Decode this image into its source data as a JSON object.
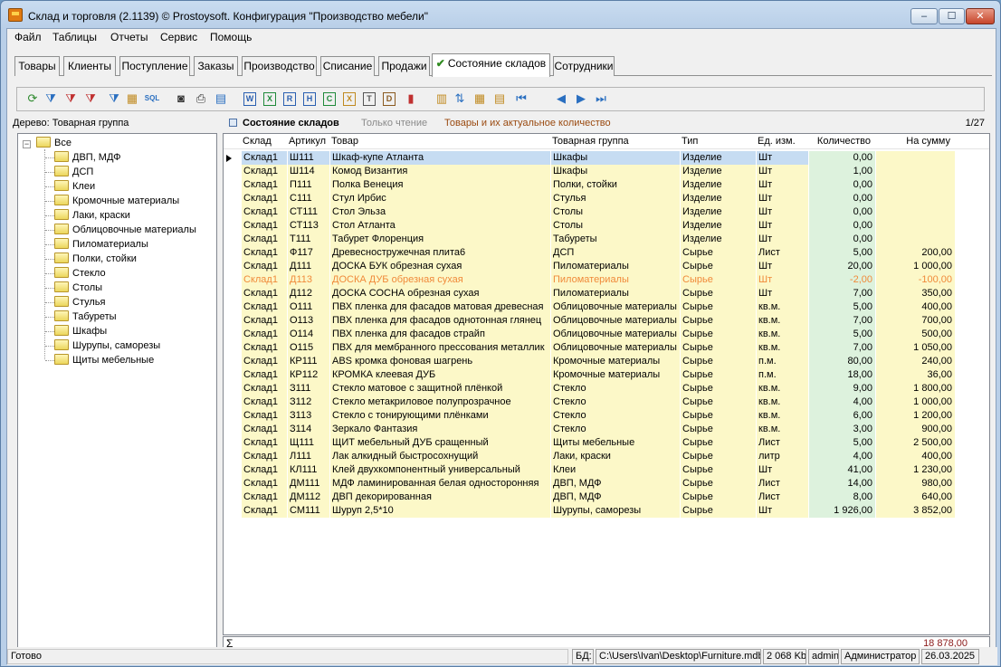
{
  "window": {
    "title": "Склад и торговля (2.1139) © Prostoysoft. Конфигурация \"Производство мебели\"",
    "minimize": "‒",
    "maximize": "☐",
    "close": "✕"
  },
  "menu": [
    "Файл",
    "Таблицы",
    "Отчеты",
    "Сервис",
    "Помощь"
  ],
  "tabs": [
    {
      "label": "Товары",
      "active": false
    },
    {
      "label": "Клиенты",
      "active": false
    },
    {
      "label": "Поступление",
      "active": false
    },
    {
      "label": "Заказы",
      "active": false
    },
    {
      "label": "Производство",
      "active": false
    },
    {
      "label": "Списание",
      "active": false
    },
    {
      "label": "Продажи",
      "active": false
    },
    {
      "label": "Состояние складов",
      "active": true
    },
    {
      "label": "Сотрудники",
      "active": false
    }
  ],
  "toolbar_icons": [
    "refresh-icon",
    "filter-icon",
    "filter-remove-icon",
    "filter-clear-icon",
    "filter-check-icon",
    "group-icon",
    "sql-icon",
    "binoculars-icon",
    "print-icon",
    "preview-icon",
    "export-word-icon",
    "export-excel-icon",
    "export-rtf-icon",
    "export-html-icon",
    "export-csv-icon",
    "export-xml-icon",
    "export-txt-icon",
    "export-dbf-icon",
    "chart-icon",
    "columns-icon",
    "sort-icon",
    "table-settings-icon",
    "form-icon",
    "first-record-icon",
    "prev-record-icon",
    "next-record-icon",
    "last-record-icon"
  ],
  "tree": {
    "label": "Дерево: Товарная группа",
    "expander": "−",
    "root": "Все",
    "items": [
      "ДВП, МДФ",
      "ДСП",
      "Клеи",
      "Кромочные материалы",
      "Лаки, краски",
      "Облицовочные материалы",
      "Пиломатериалы",
      "Полки, стойки",
      "Стекло",
      "Столы",
      "Стулья",
      "Табуреты",
      "Шкафы",
      "Шурупы, саморезы",
      "Щиты мебельные"
    ]
  },
  "grid": {
    "title": "Состояние складов",
    "mode": "Только чтение",
    "description": "Товары и их актуальное количество",
    "pager": "1/27",
    "columns": [
      "Склад",
      "Артикул",
      "Товар",
      "Товарная группа",
      "Тип",
      "Ед. изм.",
      "Количество",
      "На сумму"
    ],
    "rows": [
      [
        "Склад1",
        "Ш111",
        "Шкаф-купе Атланта",
        "Шкафы",
        "Изделие",
        "Шт",
        "0,00",
        ""
      ],
      [
        "Склад1",
        "Ш114",
        "Комод Византия",
        "Шкафы",
        "Изделие",
        "Шт",
        "1,00",
        ""
      ],
      [
        "Склад1",
        "П111",
        "Полка Венеция",
        "Полки, стойки",
        "Изделие",
        "Шт",
        "0,00",
        ""
      ],
      [
        "Склад1",
        "С111",
        "Стул Ирбис",
        "Стулья",
        "Изделие",
        "Шт",
        "0,00",
        ""
      ],
      [
        "Склад1",
        "СТ111",
        "Стол Эльза",
        "Столы",
        "Изделие",
        "Шт",
        "0,00",
        ""
      ],
      [
        "Склад1",
        "СТ113",
        "Стол Атланта",
        "Столы",
        "Изделие",
        "Шт",
        "0,00",
        ""
      ],
      [
        "Склад1",
        "Т111",
        "Табурет Флоренция",
        "Табуреты",
        "Изделие",
        "Шт",
        "0,00",
        ""
      ],
      [
        "Склад1",
        "Ф117",
        "Древесностружечная плита6",
        "ДСП",
        "Сырье",
        "Лист",
        "5,00",
        "200,00"
      ],
      [
        "Склад1",
        "Д111",
        "ДОСКА БУК обрезная сухая",
        "Пиломатериалы",
        "Сырье",
        "Шт",
        "20,00",
        "1 000,00"
      ],
      [
        "Склад1",
        "Д113",
        "ДОСКА ДУБ обрезная сухая",
        "Пиломатериалы",
        "Сырье",
        "Шт",
        "-2,00",
        "-100,00"
      ],
      [
        "Склад1",
        "Д112",
        "ДОСКА СОСНА обрезная сухая",
        "Пиломатериалы",
        "Сырье",
        "Шт",
        "7,00",
        "350,00"
      ],
      [
        "Склад1",
        "О111",
        "ПВХ пленка для фасадов матовая древесная",
        "Облицовочные материалы",
        "Сырье",
        "кв.м.",
        "5,00",
        "400,00"
      ],
      [
        "Склад1",
        "О113",
        "ПВХ пленка для фасадов однотонная глянец",
        "Облицовочные материалы",
        "Сырье",
        "кв.м.",
        "7,00",
        "700,00"
      ],
      [
        "Склад1",
        "О114",
        "ПВХ пленка для фасадов страйп",
        "Облицовочные материалы",
        "Сырье",
        "кв.м.",
        "5,00",
        "500,00"
      ],
      [
        "Склад1",
        "О115",
        "ПВХ для мембранного прессования металлик",
        "Облицовочные материалы",
        "Сырье",
        "кв.м.",
        "7,00",
        "1 050,00"
      ],
      [
        "Склад1",
        "КР111",
        "ABS кромка фоновая шагрень",
        "Кромочные материалы",
        "Сырье",
        "п.м.",
        "80,00",
        "240,00"
      ],
      [
        "Склад1",
        "КР112",
        "КРОМКА клеевая ДУБ",
        "Кромочные материалы",
        "Сырье",
        "п.м.",
        "18,00",
        "36,00"
      ],
      [
        "Склад1",
        "З111",
        "Стекло матовое с защитной плёнкой",
        "Стекло",
        "Сырье",
        "кв.м.",
        "9,00",
        "1 800,00"
      ],
      [
        "Склад1",
        "З112",
        "Стекло метакриловое полупрозрачное",
        "Стекло",
        "Сырье",
        "кв.м.",
        "4,00",
        "1 000,00"
      ],
      [
        "Склад1",
        "З113",
        "Стекло с тонирующими плёнками",
        "Стекло",
        "Сырье",
        "кв.м.",
        "6,00",
        "1 200,00"
      ],
      [
        "Склад1",
        "З114",
        "Зеркало Фантазия",
        "Стекло",
        "Сырье",
        "кв.м.",
        "3,00",
        "900,00"
      ],
      [
        "Склад1",
        "Щ111",
        "ЩИТ мебельный ДУБ сращенный",
        "Щиты мебельные",
        "Сырье",
        "Лист",
        "5,00",
        "2 500,00"
      ],
      [
        "Склад1",
        "Л111",
        "Лак алкидный быстросохнущий",
        "Лаки, краски",
        "Сырье",
        "литр",
        "4,00",
        "400,00"
      ],
      [
        "Склад1",
        "КЛ111",
        "Клей двухкомпонентный универсальный",
        "Клеи",
        "Сырье",
        "Шт",
        "41,00",
        "1 230,00"
      ],
      [
        "Склад1",
        "ДМ111",
        "МДФ ламинированная белая односторонняя",
        "ДВП, МДФ",
        "Сырье",
        "Лист",
        "14,00",
        "980,00"
      ],
      [
        "Склад1",
        "ДМ112",
        "ДВП декорированная",
        "ДВП, МДФ",
        "Сырье",
        "Лист",
        "8,00",
        "640,00"
      ],
      [
        "Склад1",
        "СМ111",
        "Шуруп 2,5*10",
        "Шурупы, саморезы",
        "Сырье",
        "Шт",
        "1 926,00",
        "3 852,00"
      ]
    ],
    "highlight_row": 9,
    "highlight_color": "#f08a3a",
    "selected_row": 0,
    "sum_symbol": "Σ",
    "total": "18 878,00",
    "total_color": "#8b1a1a"
  },
  "status": {
    "ready": "Готово",
    "db_label": "БД:",
    "db_path": "C:\\Users\\Ivan\\Desktop\\Furniture.mdb",
    "size": "2 068 Kb",
    "user": "admin",
    "role": "Администратор",
    "date": "26.03.2025"
  }
}
